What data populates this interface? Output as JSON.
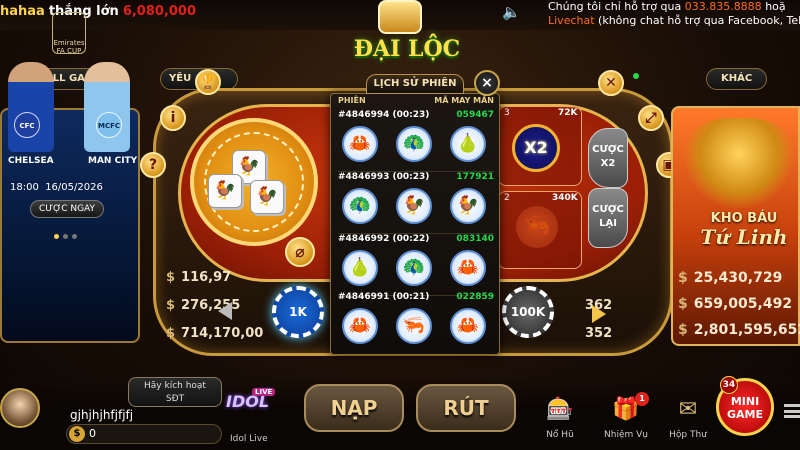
{
  "ticker": {
    "user": "hahaa",
    "text": "thắng lớn",
    "amount": "6,080,000"
  },
  "support": {
    "line1_prefix": "Chúng tôi chỉ hỗ trợ qua",
    "line1_phone": "033.835.8888",
    "line1_suffix": "hoặ",
    "line2_label": "Livechat",
    "line2_rest": "(không chat hỗ trợ qua Facebook, Tele"
  },
  "lanes": {
    "all_games": "ALL GAMES",
    "yeu_thich": "YÊU THÍCH",
    "khac": "KHÁC"
  },
  "game_title": "ĐẠI LỘC",
  "left_card": {
    "league": "Emirates FA CUP",
    "team1": "CHELSEA",
    "team2": "MAN CITY",
    "time": "18:00",
    "date": "16/05/2026",
    "bet_button": "CƯỢC NGAY"
  },
  "table": {
    "dice": [
      "🐓",
      "🐓",
      "🐓"
    ],
    "cell_x2": {
      "count": "3",
      "amount": "72K",
      "label": "X2"
    },
    "cell_redo": {
      "count": "2",
      "amount": "340K"
    },
    "bet_x2": [
      "CƯỢC",
      "X2"
    ],
    "bet_redo": [
      "CƯỢC",
      "LẠI"
    ],
    "stats_left": [
      "116,97",
      "276,255",
      "714,170,00"
    ],
    "stats_right": [
      "2",
      "362",
      "352"
    ],
    "chips": {
      "selected": "1K",
      "max": "100K"
    }
  },
  "jackpot": {
    "title_line1": "KHO BÁU",
    "title_line2": "Tứ Linh",
    "values": [
      "25,430,729",
      "659,005,492",
      "2,801,595,652"
    ]
  },
  "history": {
    "tab": "LỊCH SỬ PHIÊN",
    "close": "×",
    "col_session": "PHIÊN",
    "col_hash": "MÃ MAY MẮN",
    "rows": [
      {
        "session": "#4846994 (00:23)",
        "hash": "059467",
        "tokens": [
          "🦀",
          "🦚",
          "🍐"
        ]
      },
      {
        "session": "#4846993 (00:23)",
        "hash": "177921",
        "tokens": [
          "🦚",
          "🐓",
          "🐓"
        ]
      },
      {
        "session": "#4846992 (00:22)",
        "hash": "083140",
        "tokens": [
          "🍐",
          "🦚",
          "🦀"
        ]
      },
      {
        "session": "#4846991 (00:21)",
        "hash": "022859",
        "tokens": [
          "🦀",
          "🦐",
          "🦀"
        ]
      }
    ]
  },
  "bottom": {
    "verify": [
      "Hãy kích hoạt",
      "SĐT"
    ],
    "username": "gjhjhjhfjfjfj",
    "balance": "0",
    "idol_text": "IDOL",
    "idol_live": "LIVE",
    "idol_label": "Idol Live",
    "nap": "NẠP",
    "rut": "RÚT",
    "menu": [
      {
        "icon": "🎰",
        "label": "Nổ Hũ"
      },
      {
        "icon": "🎁",
        "label": "Nhiệm Vụ"
      },
      {
        "icon": "✉",
        "label": "Hộp Thư"
      }
    ],
    "mission_badge": "1",
    "minigame": [
      "MINI",
      "GAME"
    ],
    "minigame_badge": "34"
  }
}
